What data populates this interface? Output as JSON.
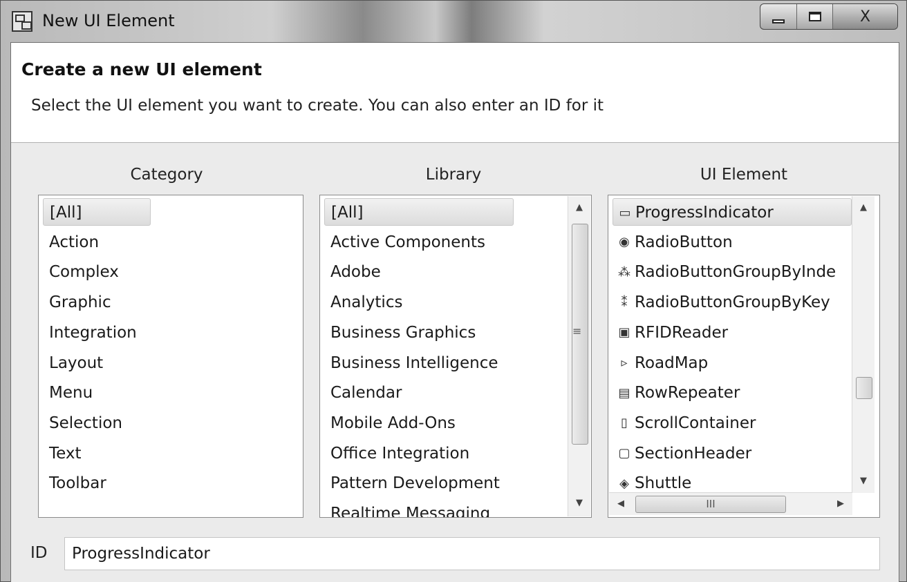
{
  "window": {
    "title": "New UI Element",
    "controls": {
      "minimize": "",
      "maximize": "",
      "close": "X"
    }
  },
  "header": {
    "title": "Create a new UI element",
    "subtitle": "Select the UI element you want to create. You can also enter an ID for it"
  },
  "category": {
    "label": "Category",
    "items": [
      "[All]",
      "Action",
      "Complex",
      "Graphic",
      "Integration",
      "Layout",
      "Menu",
      "Selection",
      "Text",
      "Toolbar"
    ],
    "selected": "[All]"
  },
  "library": {
    "label": "Library",
    "items": [
      "[All]",
      "Active Components",
      "Adobe",
      "Analytics",
      "Business Graphics",
      "Business Intelligence",
      "Calendar",
      "Mobile Add-Ons",
      "Office Integration",
      "Pattern Development",
      "Realtime Messaging"
    ],
    "selected": "[All]",
    "scrollbar_grip": "≡"
  },
  "ui_element": {
    "label": "UI Element",
    "items": [
      {
        "label": "ProgressIndicator",
        "icon": "progress-indicator-icon",
        "glyph": "▭"
      },
      {
        "label": "RadioButton",
        "icon": "radio-button-icon",
        "glyph": "◉"
      },
      {
        "label": "RadioButtonGroupByInde",
        "icon": "radio-group-index-icon",
        "glyph": "⁂"
      },
      {
        "label": "RadioButtonGroupByKey",
        "icon": "radio-group-key-icon",
        "glyph": "⁑"
      },
      {
        "label": "RFIDReader",
        "icon": "rfid-reader-icon",
        "glyph": "▣"
      },
      {
        "label": "RoadMap",
        "icon": "roadmap-icon",
        "glyph": "▹"
      },
      {
        "label": "RowRepeater",
        "icon": "row-repeater-icon",
        "glyph": "▤"
      },
      {
        "label": "ScrollContainer",
        "icon": "scroll-container-icon",
        "glyph": "▯"
      },
      {
        "label": "SectionHeader",
        "icon": "section-header-icon",
        "glyph": "▢"
      },
      {
        "label": "Shuttle",
        "icon": "shuttle-icon",
        "glyph": "◈"
      }
    ],
    "selected": "ProgressIndicator",
    "hscroll_grip": "III"
  },
  "id_field": {
    "label": "ID",
    "value": "ProgressIndicator"
  }
}
